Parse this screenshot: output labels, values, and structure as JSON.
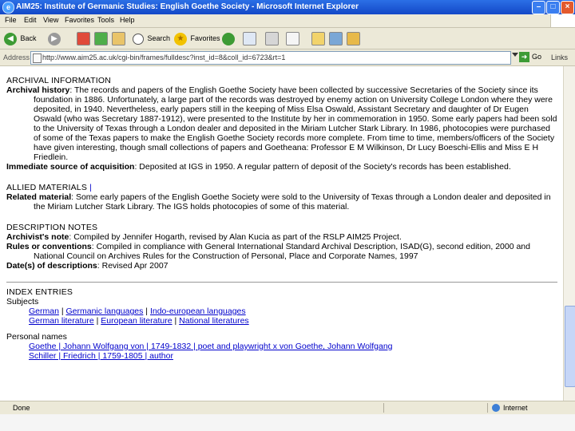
{
  "window": {
    "title": "AIM25: Institute of Germanic Studies: English Goethe Society - Microsoft Internet Explorer",
    "minimize": "–",
    "maximize": "□",
    "close": "×"
  },
  "menu": [
    "File",
    "Edit",
    "View",
    "Favorites",
    "Tools",
    "Help"
  ],
  "toolbar": {
    "back": "Back",
    "search": "Search",
    "favorites": "Favorites"
  },
  "address": {
    "label": "Address",
    "url": "http://www.aim25.ac.uk/cgi-bin/frames/fulldesc?inst_id=8&coll_id=6723&rt=1",
    "go": "Go",
    "links": "Links"
  },
  "content": {
    "archival_heading": "ARCHIVAL INFORMATION",
    "history_label": "Archival history",
    "history_text": ": The records and papers of the English Goethe Society have been collected by successive Secretaries of the Society since its foundation in 1886. Unfortunately, a large part of the records was destroyed by enemy action on University College London where they were deposited, in 1940. Nevertheless, early papers still in the keeping of Miss Elsa Oswald, Assistant Secretary and daughter of Dr Eugen Oswald (who was Secretary 1887-1912), were presented to the Institute by her in commemoration in 1950. Some early papers had been sold to the University of Texas through a London dealer and deposited in the Miriam Lutcher Stark Library. In 1986, photocopies were purchased of some of the Texas papers to make the English Goethe Society records more complete. From time to time, members/officers of the Society have given interesting, though small collections of papers and Goetheana: Professor E M Wilkinson, Dr Lucy Boeschi-Ellis and Miss E H Friedlein.",
    "acquisition_label": "Immediate source of acquisition",
    "acquisition_text": ": Deposited at IGS in 1950. A regular pattern of deposit of the Society's records has been established.",
    "allied_heading": "ALLIED MATERIALS",
    "related_label": "Related material",
    "related_text": ": Some early papers of the English Goethe Society were sold to the University of Texas through a London dealer and deposited in the Miriam Lutcher Stark Library. The IGS holds photocopies of some of this material.",
    "description_heading": "DESCRIPTION NOTES",
    "archivist_label": "Archivist's note",
    "archivist_text": ": Compiled by Jennifer Hogarth, revised by Alan Kucia as part of the RSLP AIM25 Project.",
    "rules_label": "Rules or conventions",
    "rules_text": ": Compiled in compliance with General International Standard Archival Description, ISAD(G), second edition, 2000 and National Council on Archives Rules for the Construction of Personal, Place and Corporate Names, 1997",
    "dates_label": "Date(s) of descriptions",
    "dates_text": ": Revised Apr 2007",
    "index_heading": "INDEX ENTRIES",
    "subjects_heading": "Subjects",
    "subjects": [
      [
        "German",
        "Germanic languages",
        "Indo-european languages"
      ],
      [
        "German literature",
        "European literature",
        "National literatures"
      ]
    ],
    "personal_heading": "Personal names",
    "persons": [
      "Goethe | Johann Wolfgang von | 1749-1832 | poet and playwright x von Goethe, Johann Wolfgang",
      "Schiller | Friedrich | 1759-1805 | author"
    ],
    "separator": " | "
  },
  "status": {
    "done": "Done",
    "zone": "Internet"
  }
}
